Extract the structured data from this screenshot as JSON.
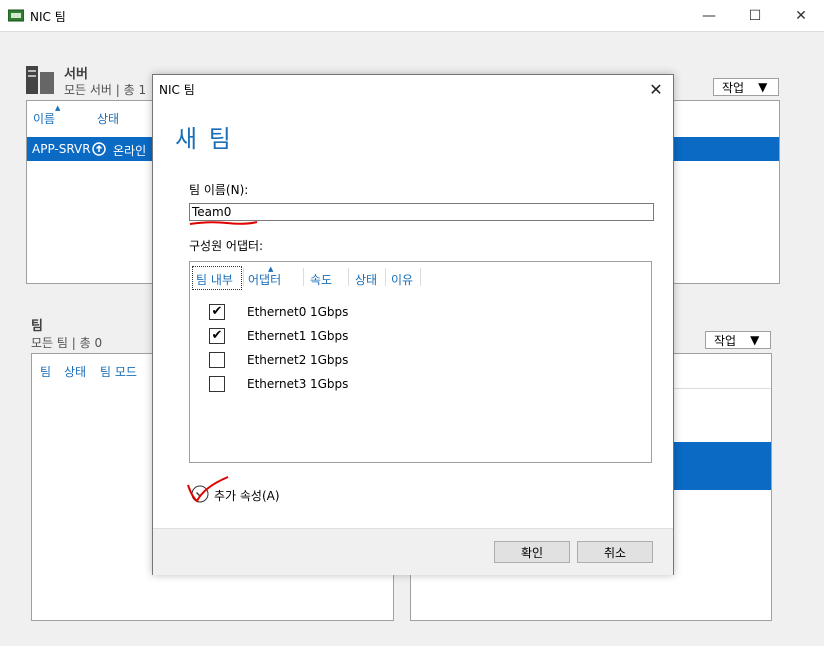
{
  "window": {
    "title": "NIC 팀",
    "minimize": "—",
    "maximize": "☐",
    "close": "✕"
  },
  "servers": {
    "title": "서버",
    "subtitle": "모든 서버 | 총 1",
    "task_button": "작업",
    "columns": [
      "이름",
      "상태"
    ],
    "rows": [
      {
        "name": "APP-SRVR",
        "status": "온라인"
      }
    ]
  },
  "teams": {
    "title": "팀",
    "subtitle": "모든 팀 | 총 0",
    "task_button": "작업",
    "columns": [
      "팀",
      "상태",
      "팀 모드"
    ]
  },
  "dialog": {
    "title": "NIC 팀",
    "close": "✕",
    "heading": "새 팀",
    "team_name_label": "팀 이름(N):",
    "team_name_value": "Team0",
    "members_label": "구성원 어댑터:",
    "adapter_columns": [
      "팀 내부",
      "어댑터",
      "속도",
      "상태",
      "이유"
    ],
    "adapters": [
      {
        "checked": true,
        "name": "Ethernet0",
        "speed": "1Gbps"
      },
      {
        "checked": true,
        "name": "Ethernet1",
        "speed": "1Gbps"
      },
      {
        "checked": false,
        "name": "Ethernet2",
        "speed": "1Gbps"
      },
      {
        "checked": false,
        "name": "Ethernet3",
        "speed": "1Gbps"
      }
    ],
    "additional_props": "추가 속성(A)",
    "ok_button": "확인",
    "cancel_button": "취소"
  },
  "colors": {
    "accent": "#1a6fb8",
    "selection": "#0a6ac4",
    "annotation": "#e00000"
  }
}
